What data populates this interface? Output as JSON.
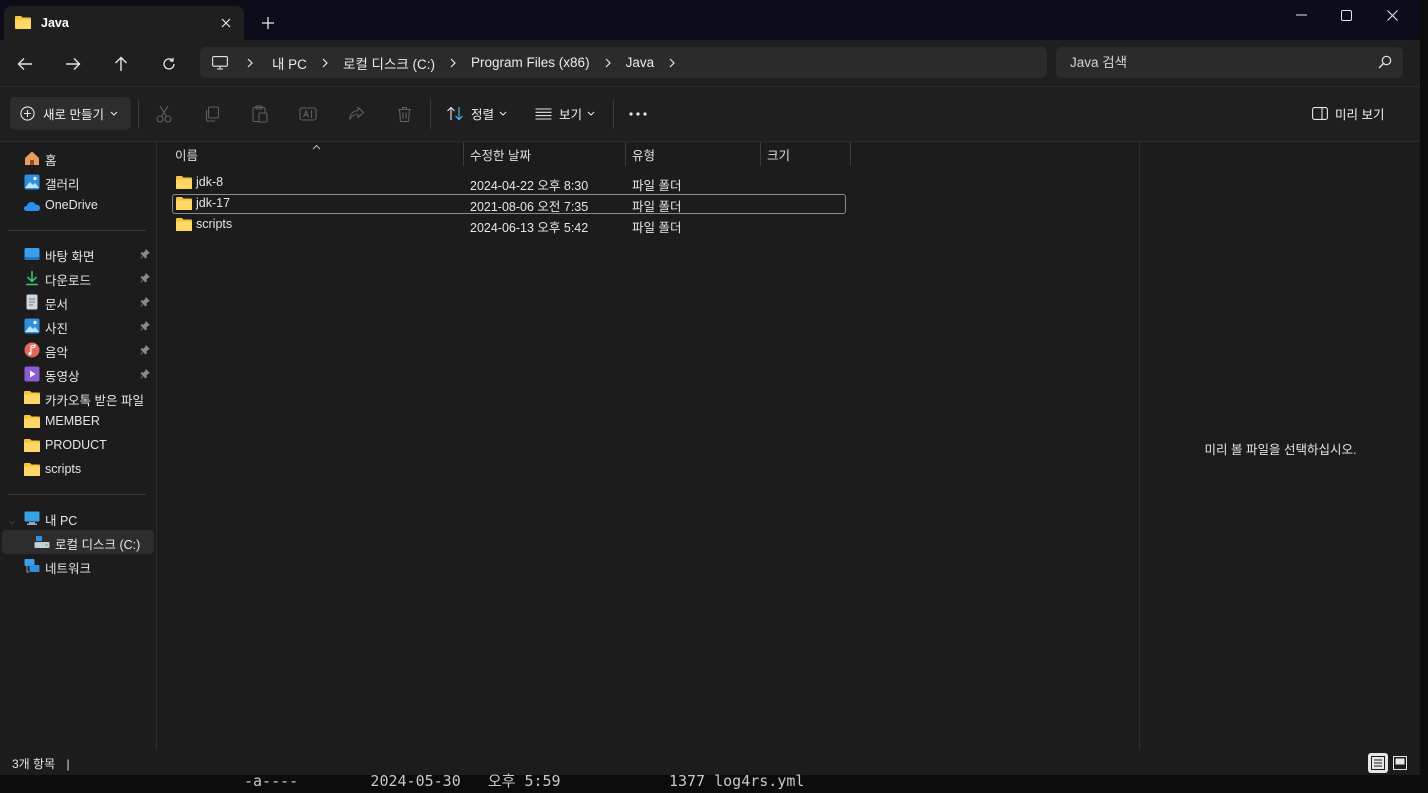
{
  "tab": {
    "title": "Java",
    "icon": "folder-icon"
  },
  "address": {
    "crumbs": [
      "내 PC",
      "로컬 디스크 (C:)",
      "Program Files (x86)",
      "Java"
    ]
  },
  "search": {
    "placeholder": "Java 검색"
  },
  "toolbar": {
    "new_label": "새로 만들기",
    "sort_label": "정렬",
    "view_label": "보기",
    "preview_label": "미리 보기"
  },
  "sidebar": {
    "quick": [
      {
        "label": "홈",
        "icon": "home-icon"
      },
      {
        "label": "갤러리",
        "icon": "gallery-icon"
      },
      {
        "label": "OneDrive",
        "icon": "onedrive-icon"
      }
    ],
    "pinned": [
      {
        "label": "바탕 화면",
        "icon": "desktop-icon",
        "pinned": true
      },
      {
        "label": "다운로드",
        "icon": "download-icon",
        "pinned": true
      },
      {
        "label": "문서",
        "icon": "document-icon",
        "pinned": true
      },
      {
        "label": "사진",
        "icon": "pictures-icon",
        "pinned": true
      },
      {
        "label": "음악",
        "icon": "music-icon",
        "pinned": true
      },
      {
        "label": "동영상",
        "icon": "video-icon",
        "pinned": true
      },
      {
        "label": "카카오톡 받은 파일",
        "icon": "folder-icon"
      },
      {
        "label": "MEMBER",
        "icon": "folder-icon"
      },
      {
        "label": "PRODUCT",
        "icon": "folder-icon"
      },
      {
        "label": "scripts",
        "icon": "folder-icon"
      }
    ],
    "pc": {
      "label": "내 PC",
      "icon": "pc-icon"
    },
    "drive": {
      "label": "로컬 디스크 (C:)",
      "icon": "drive-icon"
    },
    "network": {
      "label": "네트워크",
      "icon": "network-icon"
    }
  },
  "columns": {
    "name": "이름",
    "modified": "수정한 날짜",
    "type": "유형",
    "size": "크기"
  },
  "files": [
    {
      "name": "jdk-8",
      "modified": "2024-04-22 오후 8:30",
      "type": "파일 폴더",
      "size": "",
      "selected": false
    },
    {
      "name": "jdk-17",
      "modified": "2021-08-06 오전 7:35",
      "type": "파일 폴더",
      "size": "",
      "selected": true
    },
    {
      "name": "scripts",
      "modified": "2024-06-13 오후 5:42",
      "type": "파일 폴더",
      "size": "",
      "selected": false
    }
  ],
  "preview": {
    "message": "미리 볼 파일을 선택하십시오."
  },
  "status": {
    "count": "3개 항목",
    "divider": "|"
  },
  "terminal": {
    "line": "-a----        2024-05-30   오후 5:59            1377 log4rs.yml"
  },
  "colors": {
    "folder": "#f5c542",
    "background": "#1c1c1c",
    "accent": "#4cc2ff"
  }
}
